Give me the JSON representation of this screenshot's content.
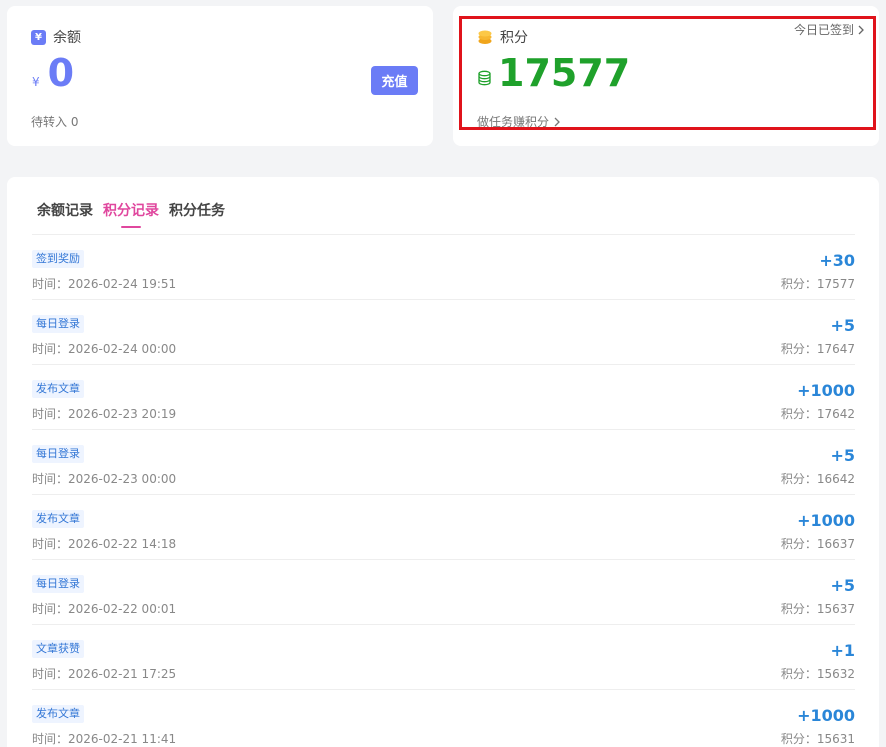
{
  "balance": {
    "label": "余额",
    "currency_symbol": "¥",
    "value": "0",
    "recharge_label": "充值",
    "pending_text": "待转入 0",
    "accent_color": "#6b7cf6"
  },
  "points": {
    "label": "积分",
    "signin_text": "今日已签到",
    "value": "17577",
    "task_link_text": "做任务赚积分",
    "accent_color": "#1fa12b"
  },
  "tabs": [
    {
      "label": "余额记录",
      "active": false
    },
    {
      "label": "积分记录",
      "active": true
    },
    {
      "label": "积分任务",
      "active": false
    }
  ],
  "records": [
    {
      "tag": "签到奖励",
      "time": "时间：2026-02-24 19:51",
      "delta": "+30",
      "total": "积分：17577"
    },
    {
      "tag": "每日登录",
      "time": "时间：2026-02-24 00:00",
      "delta": "+5",
      "total": "积分：17647"
    },
    {
      "tag": "发布文章",
      "time": "时间：2026-02-23 20:19",
      "delta": "+1000",
      "total": "积分：17642"
    },
    {
      "tag": "每日登录",
      "time": "时间：2026-02-23 00:00",
      "delta": "+5",
      "total": "积分：16642"
    },
    {
      "tag": "发布文章",
      "time": "时间：2026-02-22 14:18",
      "delta": "+1000",
      "total": "积分：16637"
    },
    {
      "tag": "每日登录",
      "time": "时间：2026-02-22 00:01",
      "delta": "+5",
      "total": "积分：15637"
    },
    {
      "tag": "文章获赞",
      "time": "时间：2026-02-21 17:25",
      "delta": "+1",
      "total": "积分：15632"
    },
    {
      "tag": "发布文章",
      "time": "时间：2026-02-21 11:41",
      "delta": "+1000",
      "total": "积分：15631"
    }
  ]
}
